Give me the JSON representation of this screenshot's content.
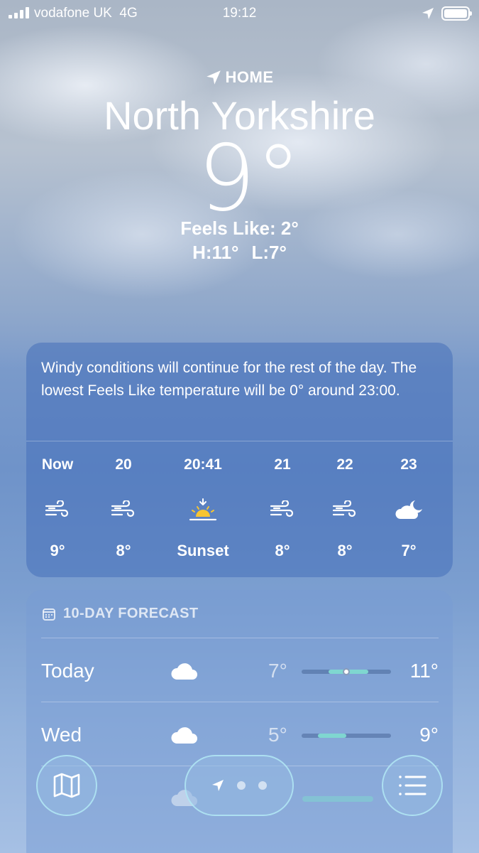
{
  "status_bar": {
    "carrier": "vodafone UK",
    "network": "4G",
    "time": "19:12",
    "icons": [
      "signal-icon",
      "location-arrow-icon",
      "battery-icon"
    ]
  },
  "location": {
    "label": "HOME",
    "city": "North Yorkshire",
    "temperature": "9°",
    "feels_like": "Feels Like: 2°",
    "high": "H:11°",
    "low": "L:7°"
  },
  "hourly": {
    "summary": "Windy conditions will continue for the rest of the day. The lowest Feels Like temperature will be 0° around 23:00.",
    "hours": [
      {
        "label": "Now",
        "icon": "wind-icon",
        "value": "9°"
      },
      {
        "label": "20",
        "icon": "wind-icon",
        "value": "8°"
      },
      {
        "label": "20:41",
        "icon": "sunset-icon",
        "value": "Sunset"
      },
      {
        "label": "21",
        "icon": "wind-icon",
        "value": "8°"
      },
      {
        "label": "22",
        "icon": "wind-icon",
        "value": "8°"
      },
      {
        "label": "23",
        "icon": "partly-cloudy-night-icon",
        "value": "7°"
      }
    ]
  },
  "daily": {
    "title": "10-DAY FORECAST",
    "days": [
      {
        "day": "Today",
        "icon": "cloud-icon",
        "low": "7°",
        "high": "11°",
        "range_start": 0.3,
        "range_end": 0.75,
        "current": 0.5
      },
      {
        "day": "Wed",
        "icon": "cloud-icon",
        "low": "5°",
        "high": "9°",
        "range_start": 0.18,
        "range_end": 0.5
      }
    ]
  },
  "toolbar": {
    "map_icon": "map-icon",
    "location_icon": "location-arrow-icon",
    "list_icon": "list-icon"
  },
  "colors": {
    "range_fill": "#7fd6d0",
    "card_blue": "#4670b9"
  }
}
